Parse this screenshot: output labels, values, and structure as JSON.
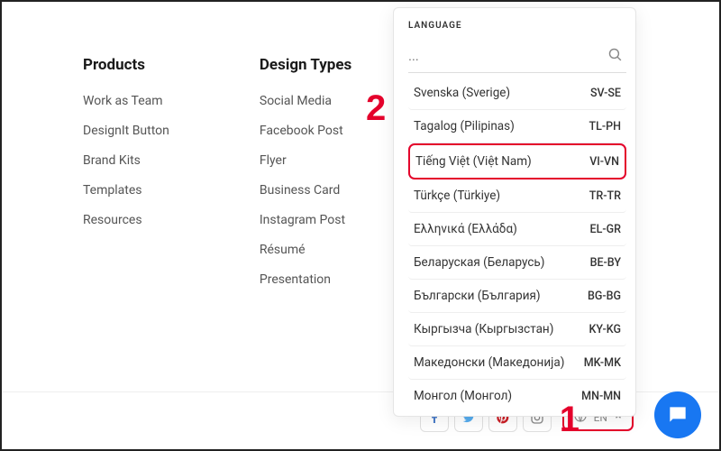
{
  "columns": {
    "products": {
      "heading": "Products",
      "links": [
        "Work as Team",
        "DesignIt Button",
        "Brand Kits",
        "Templates",
        "Resources"
      ]
    },
    "design_types": {
      "heading": "Design Types",
      "links": [
        "Social Media",
        "Facebook Post",
        "Flyer",
        "Business Card",
        "Instagram Post",
        "Résumé",
        "Presentation"
      ]
    }
  },
  "lang_dropdown": {
    "label": "LANGUAGE",
    "search_placeholder": "...",
    "items": [
      {
        "name": "Svenska (Sverige)",
        "code": "SV-SE"
      },
      {
        "name": "Tagalog (Pilipinas)",
        "code": "TL-PH"
      },
      {
        "name": "Tiếng Việt (Việt Nam)",
        "code": "VI-VN",
        "highlight": true
      },
      {
        "name": "Türkçe (Türkiye)",
        "code": "TR-TR"
      },
      {
        "name": "Ελληνικά (Ελλάδα)",
        "code": "EL-GR"
      },
      {
        "name": "Беларуская (Беларусь)",
        "code": "BE-BY"
      },
      {
        "name": "Български (България)",
        "code": "BG-BG"
      },
      {
        "name": "Кыргызча (Кыргызстан)",
        "code": "KY-KG"
      },
      {
        "name": "Македонски (Македонија)",
        "code": "MK-MK"
      },
      {
        "name": "Монгол (Монгол)",
        "code": "MN-MN"
      }
    ]
  },
  "lang_selector": {
    "text": "EN"
  },
  "annotations": {
    "one": "1",
    "two": "2"
  }
}
